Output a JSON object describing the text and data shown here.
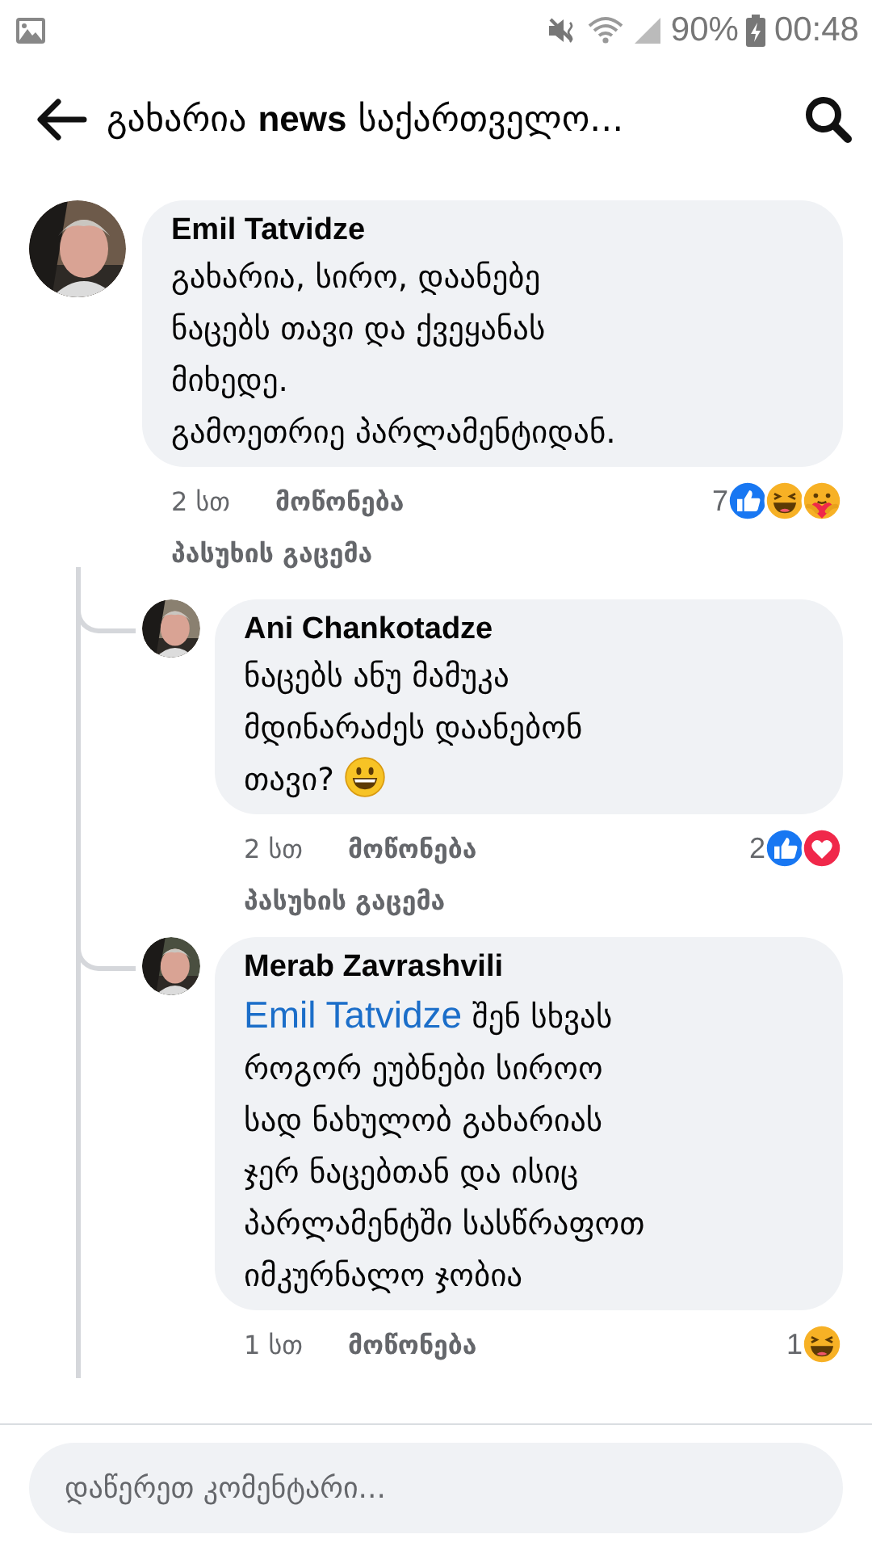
{
  "status_bar": {
    "battery": "90%",
    "time": "00:48"
  },
  "header": {
    "title": "გახარია **news** საქართველო..."
  },
  "comments": [
    {
      "kind": "comment",
      "author": "Emil Tatvidze",
      "lines": [
        "გახარია, სირო, დაანებე",
        "ნაცებს თავი და ქვეყანას",
        "მიხედე.",
        "გამოეთრიე პარლამენტიდან."
      ],
      "time": "2 სთ",
      "like": "მოწონება",
      "reply": "პასუხის გაცემა",
      "reaction_count": "7",
      "reactions": [
        {
          "kind": "like"
        },
        {
          "kind": "haha"
        },
        {
          "kind": "care"
        }
      ]
    },
    {
      "kind": "reply",
      "author": "Ani Chankotadze",
      "lines": [
        "ნაცებს ანუ მამუკა",
        "მდინარაძეს დაანებონ",
        "თავი?"
      ],
      "emoji": {
        "kind": "grinning"
      },
      "time": "2 სთ",
      "like": "მოწონება",
      "reply": "პასუხის გაცემა",
      "reaction_count": "2",
      "reactions": [
        {
          "kind": "like"
        },
        {
          "kind": "love"
        }
      ]
    },
    {
      "kind": "reply",
      "author": "Merab Zavrashvili",
      "mention": "Emil Tatvidze",
      "lines": [
        "შენ სხვას",
        "როგორ ეუბნები სიროო",
        "სად ნახულობ გახარიას",
        "ჯერ ნაცებთან და ისიც",
        "პარლამენტში სასწრაფოთ",
        "იმკურნალო ჯობია"
      ],
      "time": "1 სთ",
      "like": "მოწონება",
      "reaction_count": "1",
      "reactions": [
        {
          "kind": "haha"
        }
      ]
    }
  ],
  "composer": {
    "placeholder": "დაწერეთ კომენტარი..."
  }
}
